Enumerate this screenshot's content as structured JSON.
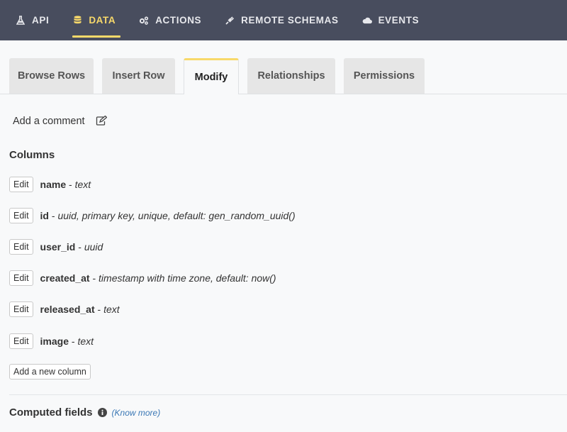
{
  "nav": {
    "items": [
      {
        "label": "API",
        "icon": "flask-icon"
      },
      {
        "label": "DATA",
        "icon": "database-icon",
        "active": true
      },
      {
        "label": "ACTIONS",
        "icon": "cogs-icon"
      },
      {
        "label": "REMOTE SCHEMAS",
        "icon": "plug-icon"
      },
      {
        "label": "EVENTS",
        "icon": "cloud-icon"
      }
    ]
  },
  "tabs": [
    {
      "label": "Browse Rows"
    },
    {
      "label": "Insert Row"
    },
    {
      "label": "Modify",
      "active": true
    },
    {
      "label": "Relationships"
    },
    {
      "label": "Permissions"
    }
  ],
  "comment": {
    "label": "Add a comment"
  },
  "columns": {
    "heading": "Columns",
    "edit_label": "Edit",
    "items": [
      {
        "name": "name",
        "sep": " - ",
        "type": "text"
      },
      {
        "name": "id",
        "sep": " - ",
        "type": "uuid, primary key, unique, default: gen_random_uuid()"
      },
      {
        "name": "user_id",
        "sep": " - ",
        "type": "uuid"
      },
      {
        "name": "created_at",
        "sep": " - ",
        "type": "timestamp with time zone, default: now()"
      },
      {
        "name": "released_at",
        "sep": " - ",
        "type": "text"
      },
      {
        "name": "image",
        "sep": " - ",
        "type": "text"
      }
    ],
    "add_label": "Add a new column"
  },
  "computed": {
    "heading": "Computed fields",
    "know_more": "(Know more)"
  },
  "colors": {
    "nav_bg": "#484d5e",
    "accent": "#f8d96a",
    "link": "#3b78b5"
  }
}
